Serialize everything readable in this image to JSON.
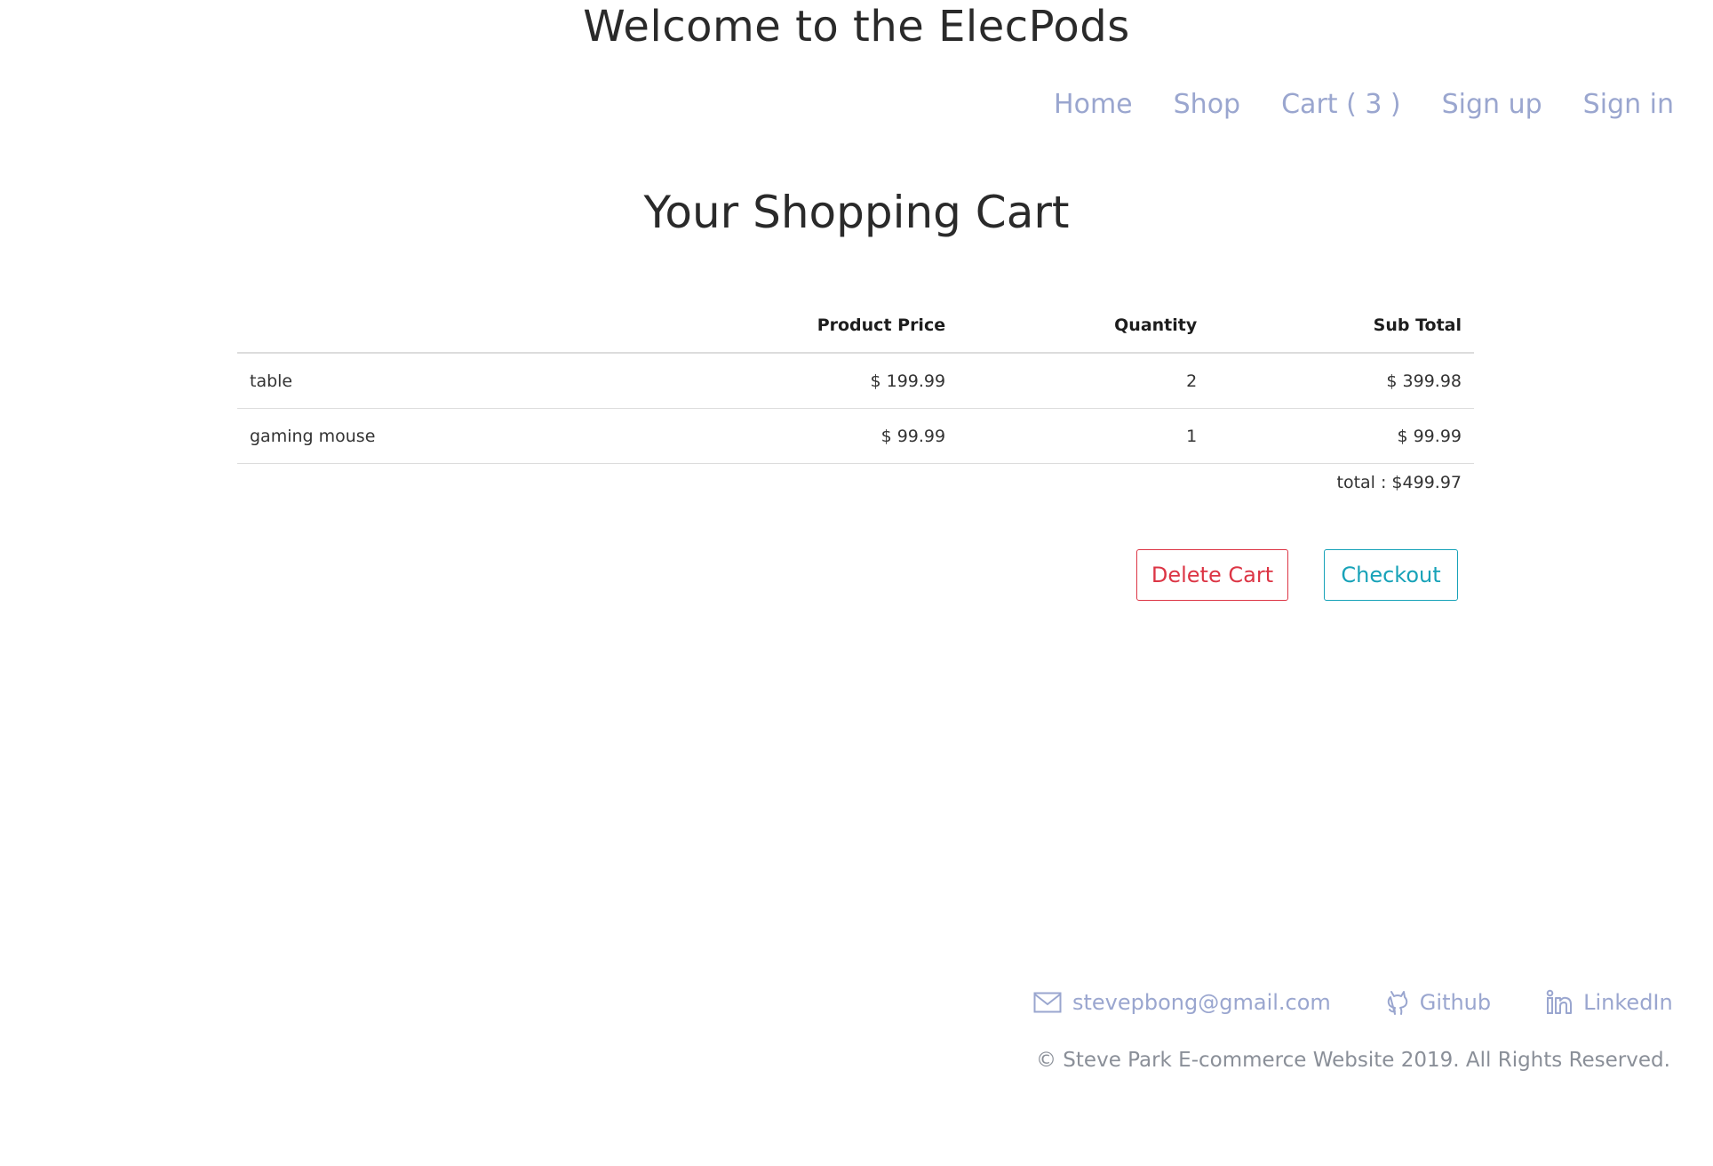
{
  "header": {
    "title": "Welcome to the ElecPods"
  },
  "nav": {
    "home": "Home",
    "shop": "Shop",
    "cart": "Cart ( 3 )",
    "signup": "Sign up",
    "signin": "Sign in"
  },
  "cart": {
    "heading": "Your Shopping Cart",
    "columns": [
      "",
      "Product Price",
      "Quantity",
      "Sub Total"
    ],
    "rows": [
      {
        "name": "table",
        "price": "$ 199.99",
        "quantity": "2",
        "subtotal": "$ 399.98"
      },
      {
        "name": "gaming mouse",
        "price": "$ 99.99",
        "quantity": "1",
        "subtotal": "$ 99.99"
      }
    ],
    "total": "total : $499.97",
    "delete_label": "Delete Cart",
    "checkout_label": "Checkout"
  },
  "footer": {
    "email": "stevepbong@gmail.com",
    "github": "Github",
    "linkedin": "LinkedIn",
    "copyright": "© Steve Park E-commerce Website 2019. All Rights Reserved.",
    "icons": {
      "email": "mail-icon",
      "github": "github-icon",
      "linkedin": "linkedin-icon"
    }
  },
  "colors": {
    "nav_link": "#9aa6cf",
    "delete": "#dc3545",
    "checkout": "#17a2b8"
  }
}
